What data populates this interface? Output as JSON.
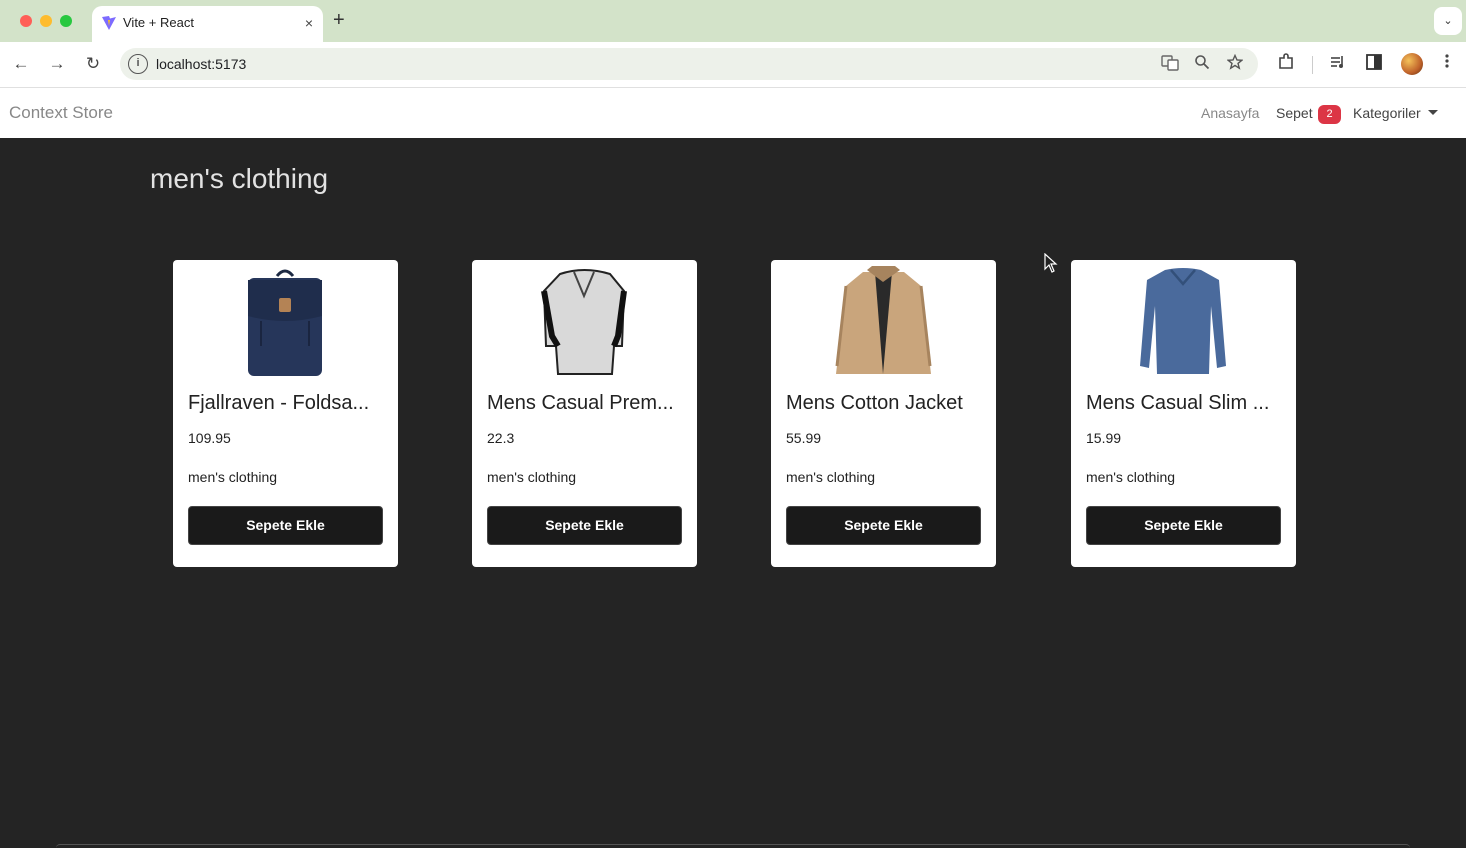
{
  "browser": {
    "tab_title": "Vite + React",
    "tab_close": "×",
    "new_tab": "+",
    "tab_menu": "⌄",
    "url": "localhost:5173",
    "back": "←",
    "forward": "→",
    "reload": "↻",
    "info": "i"
  },
  "nav": {
    "brand": "Context Store",
    "home": "Anasayfa",
    "cart": "Sepet",
    "cart_count": "2",
    "categories": "Kategoriler"
  },
  "page": {
    "title": "men's clothing"
  },
  "products": [
    {
      "title": "Fjallraven - Foldsa...",
      "price": "109.95",
      "category": "men's clothing",
      "button": "Sepete Ekle",
      "image": "backpack"
    },
    {
      "title": "Mens Casual Prem...",
      "price": "22.3",
      "category": "men's clothing",
      "button": "Sepete Ekle",
      "image": "henley-shirt"
    },
    {
      "title": "Mens Cotton Jacket",
      "price": "55.99",
      "category": "men's clothing",
      "button": "Sepete Ekle",
      "image": "cotton-jacket"
    },
    {
      "title": "Mens Casual Slim ...",
      "price": "15.99",
      "category": "men's clothing",
      "button": "Sepete Ekle",
      "image": "long-sleeve-tee"
    }
  ],
  "colors": {
    "page_bg": "#242424",
    "badge": "#dc3545",
    "button_bg": "#1a1a1a",
    "tabbar": "#d3e3c9"
  }
}
